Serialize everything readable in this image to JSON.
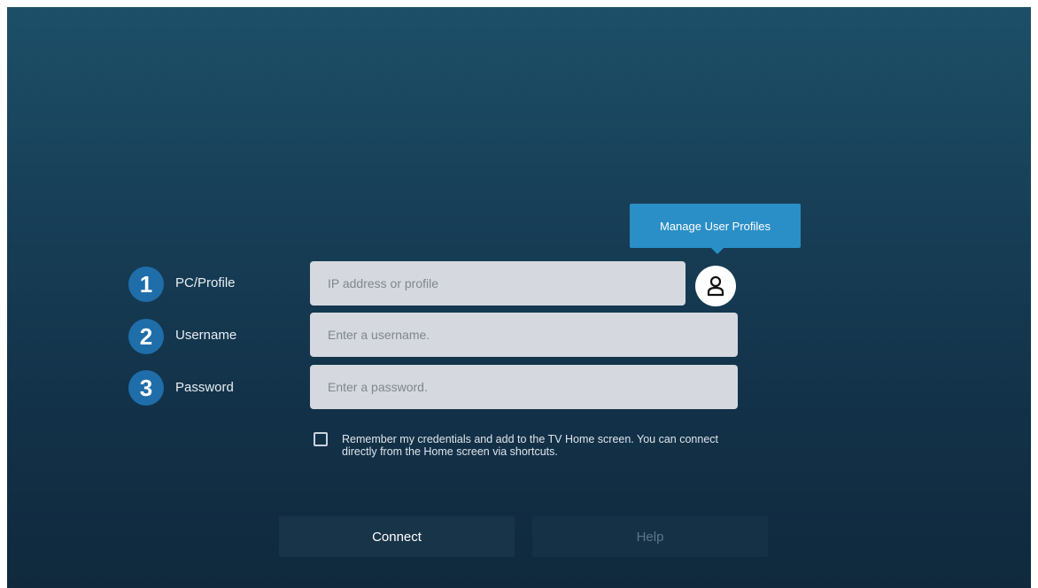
{
  "tooltip": {
    "label": "Manage User Profiles"
  },
  "steps": [
    {
      "number": "1",
      "label": "PC/Profile"
    },
    {
      "number": "2",
      "label": "Username"
    },
    {
      "number": "3",
      "label": "Password"
    }
  ],
  "fields": {
    "pc_profile": {
      "placeholder": "IP address or profile",
      "value": ""
    },
    "username": {
      "placeholder": "Enter a username.",
      "value": ""
    },
    "password": {
      "placeholder": "Enter a password.",
      "value": ""
    }
  },
  "remember": {
    "checked": false,
    "line1": "Remember my credentials and add to the TV Home screen. You can connect",
    "line2": "directly from the Home screen via shortcuts."
  },
  "buttons": {
    "connect": "Connect",
    "help": "Help"
  },
  "icons": {
    "profile": "user-icon"
  },
  "colors": {
    "accent": "#2a8fc6",
    "badge": "#1f6ea9",
    "field_bg": "#d5d9df"
  }
}
